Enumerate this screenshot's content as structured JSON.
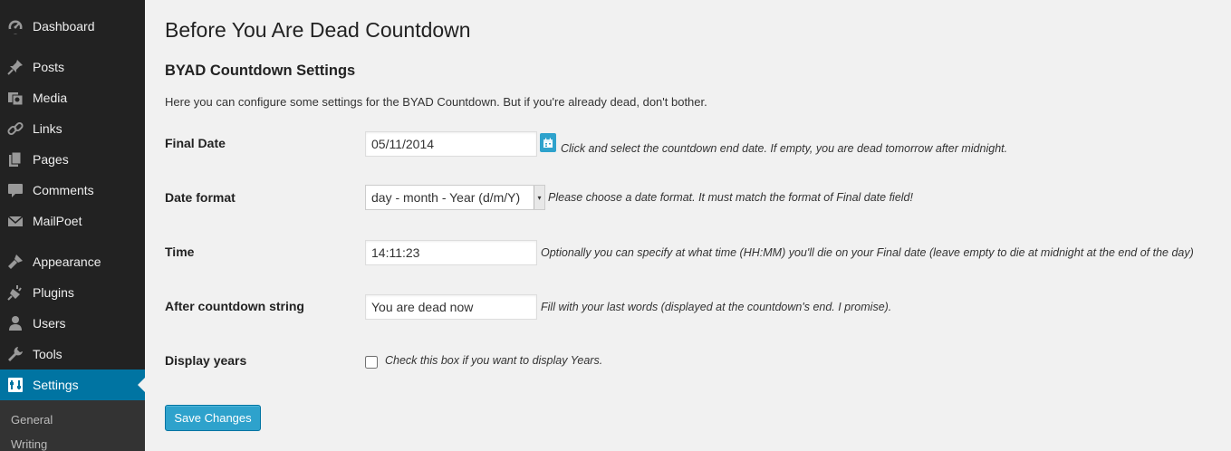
{
  "sidebar": {
    "items": [
      {
        "label": "Dashboard",
        "icon": "dashboard-icon"
      },
      {
        "label": "Posts",
        "icon": "pin-icon"
      },
      {
        "label": "Media",
        "icon": "media-icon"
      },
      {
        "label": "Links",
        "icon": "link-icon"
      },
      {
        "label": "Pages",
        "icon": "pages-icon"
      },
      {
        "label": "Comments",
        "icon": "comment-icon"
      },
      {
        "label": "MailPoet",
        "icon": "envelope-icon"
      },
      {
        "label": "Appearance",
        "icon": "brush-icon"
      },
      {
        "label": "Plugins",
        "icon": "plug-icon"
      },
      {
        "label": "Users",
        "icon": "user-icon"
      },
      {
        "label": "Tools",
        "icon": "wrench-icon"
      },
      {
        "label": "Settings",
        "icon": "settings-icon"
      }
    ],
    "current": "Settings",
    "submenu": [
      "General",
      "Writing"
    ]
  },
  "page": {
    "title": "Before You Are Dead Countdown",
    "section_title": "BYAD Countdown Settings",
    "intro": "Here you can configure some settings for the BYAD Countdown. But if you're already dead, don't bother."
  },
  "form": {
    "final_date": {
      "label": "Final Date",
      "value": "05/11/2014",
      "description": "Click and select the countdown end date. If empty, you are dead tomorrow after midnight."
    },
    "date_format": {
      "label": "Date format",
      "value": "day - month - Year (d/m/Y)",
      "description": "Please choose a date format. It must match the format of Final date field!"
    },
    "time": {
      "label": "Time",
      "value": "14:11:23",
      "description": "Optionally you can specify at what time (HH:MM) you'll die on your Final date (leave empty to die at midnight at the end of the day)"
    },
    "after_string": {
      "label": "After countdown string",
      "value": "You are dead now",
      "description": "Fill with your last words (displayed at the countdown's end. I promise)."
    },
    "display_years": {
      "label": "Display years",
      "checked": false,
      "description": "Check this box if you want to display Years."
    },
    "save_label": "Save Changes"
  },
  "colors": {
    "sidebar_bg": "#222222",
    "accent": "#0074a2",
    "button": "#2ea2cc",
    "page_bg": "#f1f1f1"
  }
}
